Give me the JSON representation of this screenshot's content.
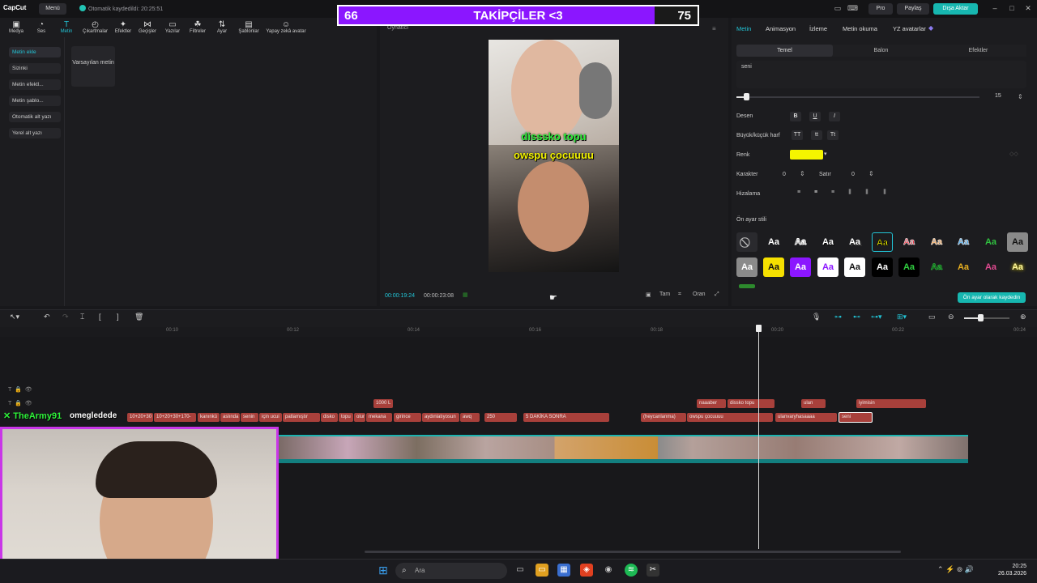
{
  "app": {
    "logo_text": "CapCut",
    "menu_label": "Menü",
    "autosave_text": "Otomatik kaydedildi: 20:25:51",
    "pro_label": "Pro",
    "share_label": "Paylaş",
    "export_label": "Dışa Aktar"
  },
  "follower_overlay": {
    "current": "66",
    "title": "TAKİPÇİLER <3",
    "goal": "75",
    "progress_fraction": 0.88
  },
  "toolbar": {
    "items": [
      {
        "label": "Medya",
        "icon": "media-icon"
      },
      {
        "label": "Ses",
        "icon": "audio-icon"
      },
      {
        "label": "Metin",
        "icon": "text-icon"
      },
      {
        "label": "Çıkartmalar",
        "icon": "sticker-icon"
      },
      {
        "label": "Efektler",
        "icon": "effects-icon"
      },
      {
        "label": "Geçişler",
        "icon": "transition-icon"
      },
      {
        "label": "Yazılar",
        "icon": "captions-icon"
      },
      {
        "label": "Filtreler",
        "icon": "filter-icon"
      },
      {
        "label": "Ayar",
        "icon": "adjust-icon"
      },
      {
        "label": "Şablonlar",
        "icon": "template-icon"
      },
      {
        "label": "Yapay zekâ avatar",
        "icon": "ai-avatar-icon"
      }
    ],
    "active_index": 2
  },
  "left_sidebar": {
    "items": [
      "Metin ekle",
      "Sizinki",
      "Metin efektl...",
      "Metin şablo...",
      "Otomatik alt yazı",
      "Yerel alt yazı"
    ],
    "active_index": 0
  },
  "default_text_card": "Varsayılan metin",
  "player": {
    "label": "Oynatıcı",
    "caption_line1": "disssko topu",
    "caption_line2": "owspu çocuuuu",
    "time_current": "00:00:19:24",
    "time_total": "00:00:23:08",
    "full_label": "Tam",
    "ratio_label": "Oran"
  },
  "right_panel": {
    "tabs": [
      "Metin",
      "Animasyon",
      "İzleme",
      "Metin okuma",
      "YZ avatarlar"
    ],
    "active_tab": 0,
    "subtabs": [
      "Temel",
      "Balon",
      "Efektler"
    ],
    "active_subtab": 0,
    "text_value": "seni",
    "font_size": "15",
    "size_fraction": 0.04,
    "pattern_label": "Desen",
    "bold": "B",
    "underline": "U",
    "italic": "I",
    "case_label": "Büyük/küçük harf",
    "case_options": [
      "TT",
      "tt",
      "Tt"
    ],
    "color_label": "Renk",
    "color_value": "#f5f500",
    "char_label": "Karakter",
    "char_value": "0",
    "line_label": "Satır",
    "line_value": "0",
    "align_label": "Hizalama",
    "preset_label": "Ön ayar stili",
    "preset_glyph": "Aa",
    "save_preset_label": "Ön ayar olarak kaydedin"
  },
  "timeline": {
    "ticks": [
      "00:10",
      "00:12",
      "00:14",
      "00:16",
      "00:18",
      "00:20",
      "00:22",
      "00:24"
    ],
    "upper_clips": [
      "1000 L",
      "naaaber",
      "dissko topu",
      "ulan",
      "iyimisin"
    ],
    "lower_clips": [
      "10+20+30",
      "10+20+30+170-",
      "kanınkü",
      "aslında",
      "senin",
      "için ucui",
      "patlamıştır",
      "disko",
      "topu",
      "olur",
      "mekana",
      "girince",
      "aydınlatıyosun",
      "awq",
      "250",
      "5 DAKİKA SONRA",
      "(heycanlanma)",
      "owspu çocuuuu",
      "ulanvaryhasaaaa",
      "seni"
    ]
  },
  "stream": {
    "username": "TheArmy91",
    "message": "omegledede"
  },
  "taskbar": {
    "search_placeholder": "Ara",
    "time": "20:25",
    "date": "26.03.2026"
  },
  "colors": {
    "accent": "#22c4d6",
    "export": "#17b7b0",
    "follower_fill": "#8b16ff",
    "clip": "#a8403b",
    "webcam_border": "#c936e8",
    "username": "#2ef23a"
  }
}
